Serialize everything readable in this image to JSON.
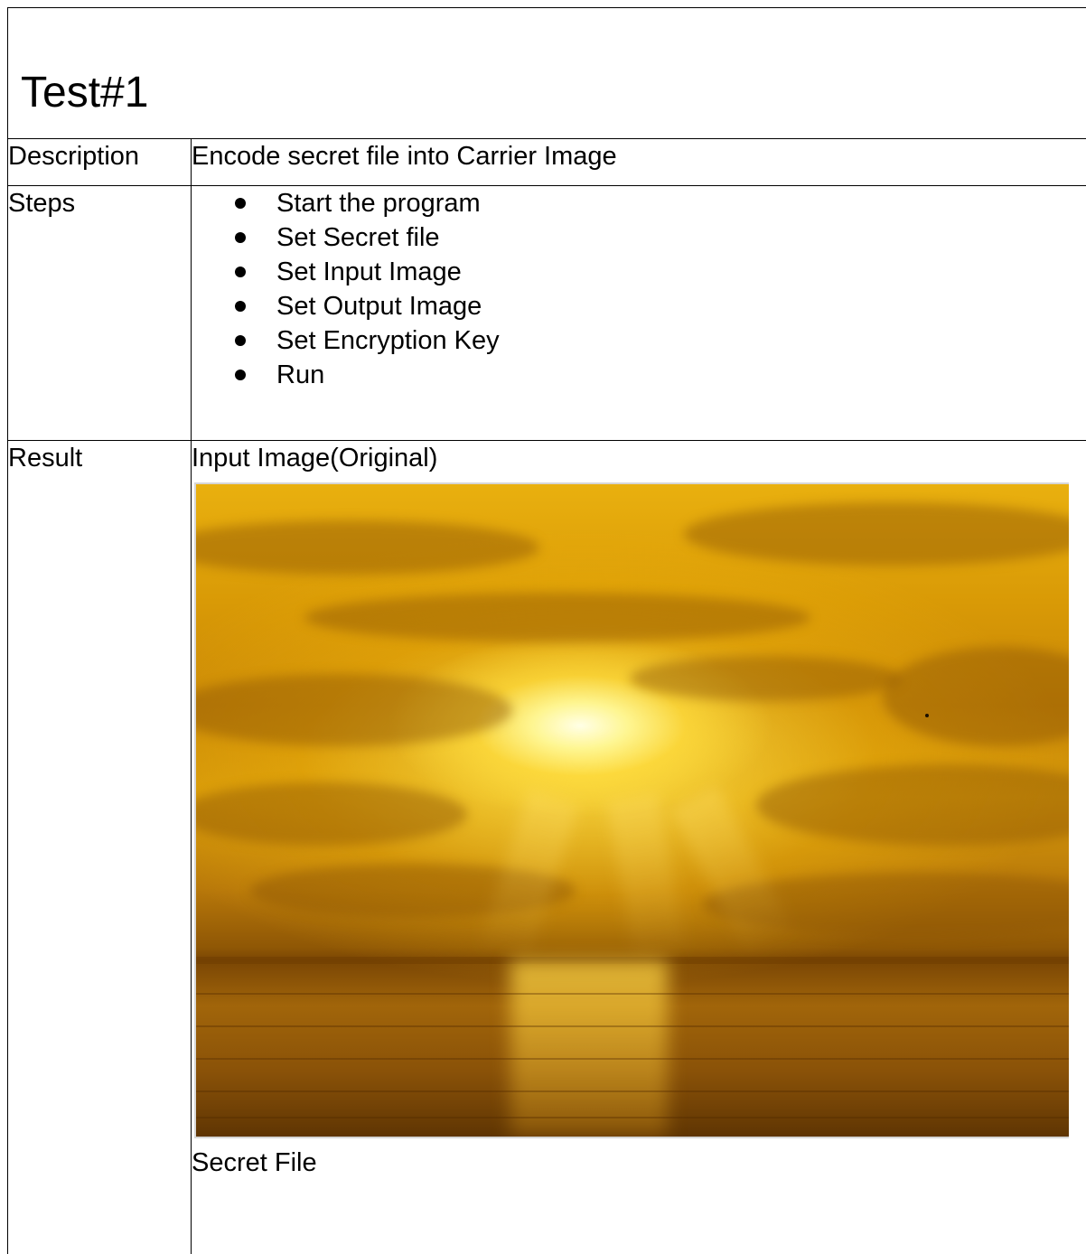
{
  "doc": {
    "title": "Test#1",
    "rows": {
      "description": {
        "label": "Description",
        "value": "Encode secret file into Carrier Image"
      },
      "steps": {
        "label": "Steps",
        "items": [
          "Start the program",
          "Set Secret file",
          "Set Input Image",
          "Set Output Image",
          "Set Encryption Key",
          "Run"
        ]
      },
      "result": {
        "label": "Result",
        "input_image_caption": "Input Image(Original)",
        "image_subject": "sunset-over-sea-photo",
        "secret_file_caption": "Secret File"
      }
    }
  }
}
